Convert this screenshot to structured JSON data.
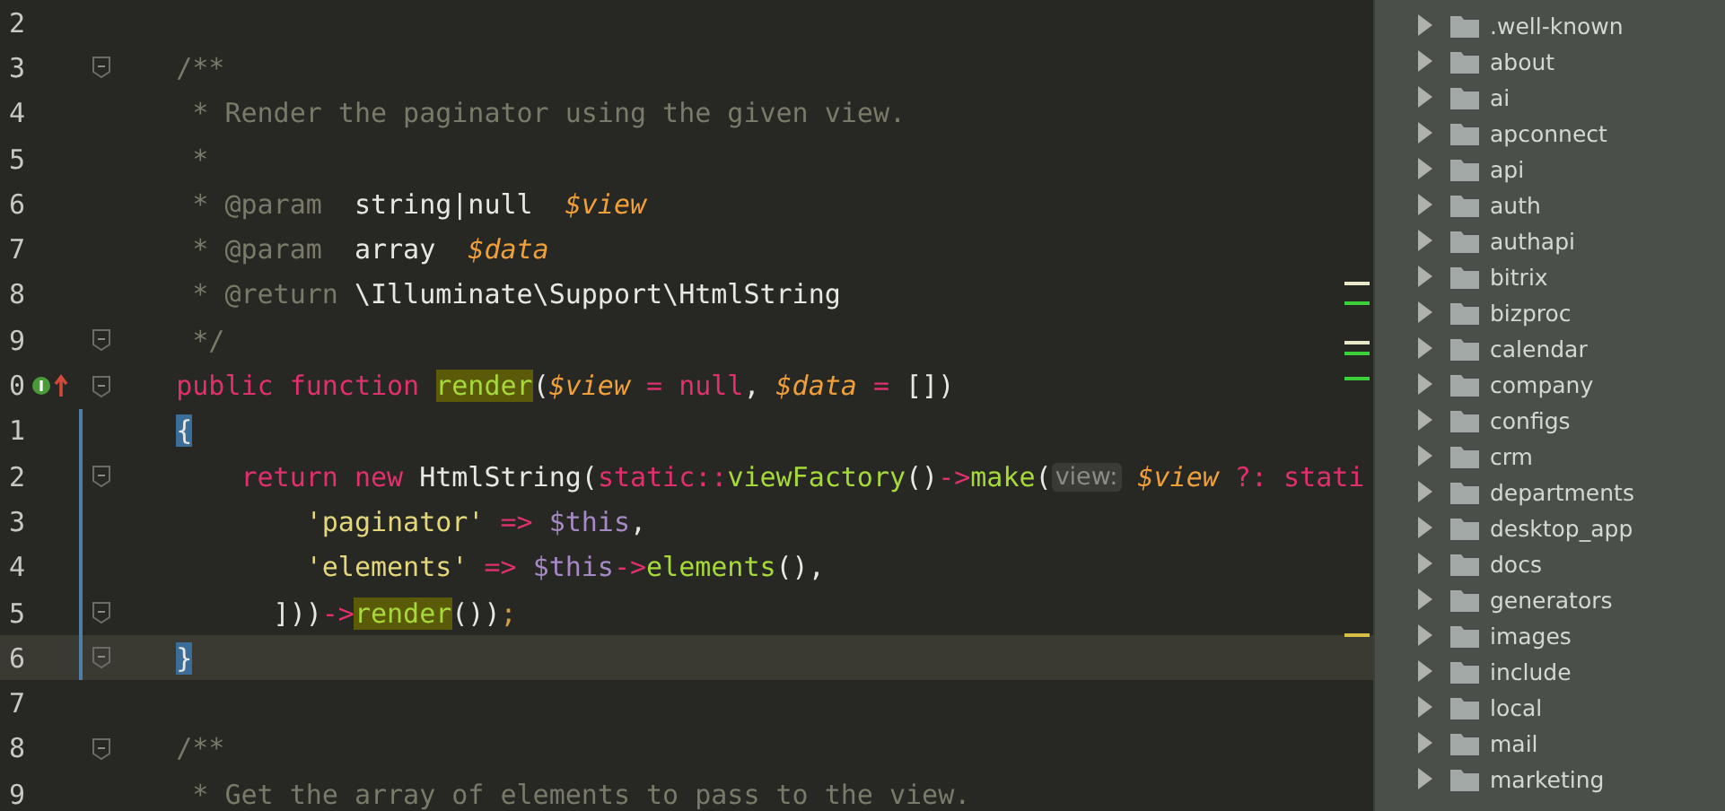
{
  "editor": {
    "lines": [
      {
        "number": "2",
        "fold": false,
        "current": false,
        "changed": false,
        "marker": false
      },
      {
        "number": "3",
        "fold": true,
        "current": false,
        "changed": false,
        "marker": false,
        "tokens": [
          {
            "t": "    /**",
            "kind": "comment"
          }
        ]
      },
      {
        "number": "4",
        "fold": false,
        "current": false,
        "changed": false,
        "marker": false,
        "tokens": [
          {
            "t": "     * Render the paginator using the given view.",
            "kind": "comment"
          }
        ]
      },
      {
        "number": "5",
        "fold": false,
        "current": false,
        "changed": false,
        "marker": false,
        "tokens": [
          {
            "t": "     *",
            "kind": "comment"
          }
        ]
      },
      {
        "number": "6",
        "fold": false,
        "current": false,
        "changed": false,
        "marker": false,
        "tokens": [
          {
            "t": "     * ",
            "kind": "comment"
          },
          {
            "t": "@param",
            "kind": "doctag"
          },
          {
            "t": "  string|null  ",
            "kind": "type"
          },
          {
            "t": "$view",
            "kind": "var"
          }
        ]
      },
      {
        "number": "7",
        "fold": false,
        "current": false,
        "changed": false,
        "marker": false,
        "tokens": [
          {
            "t": "     * ",
            "kind": "comment"
          },
          {
            "t": "@param",
            "kind": "doctag"
          },
          {
            "t": "  array  ",
            "kind": "type"
          },
          {
            "t": "$data",
            "kind": "var"
          }
        ]
      },
      {
        "number": "8",
        "fold": false,
        "current": false,
        "changed": false,
        "marker": false,
        "tokens": [
          {
            "t": "     * ",
            "kind": "comment"
          },
          {
            "t": "@return",
            "kind": "doctag"
          },
          {
            "t": " \\Illuminate\\Support\\HtmlString",
            "kind": "type"
          }
        ]
      },
      {
        "number": "9",
        "fold": true,
        "current": false,
        "changed": false,
        "marker": false,
        "tokens": [
          {
            "t": "     */",
            "kind": "comment"
          }
        ]
      },
      {
        "number": "0",
        "fold": true,
        "current": false,
        "changed": false,
        "marker": true,
        "tokens": [
          {
            "t": "    public function ",
            "kind": "keyword"
          },
          {
            "t": "render",
            "kind": "func",
            "highlighted": true
          },
          {
            "t": "(",
            "kind": "plain"
          },
          {
            "t": "$view",
            "kind": "var"
          },
          {
            "t": " = ",
            "kind": "op"
          },
          {
            "t": "null",
            "kind": "keyword"
          },
          {
            "t": ", ",
            "kind": "plain"
          },
          {
            "t": "$data",
            "kind": "var"
          },
          {
            "t": " = ",
            "kind": "op"
          },
          {
            "t": "[])",
            "kind": "plain"
          }
        ]
      },
      {
        "number": "1",
        "fold": false,
        "current": false,
        "changed": true,
        "marker": false,
        "tokens": [
          {
            "t": "    {",
            "kind": "brace"
          }
        ]
      },
      {
        "number": "2",
        "fold": true,
        "current": false,
        "changed": true,
        "marker": false,
        "tokens": [
          {
            "t": "        return new ",
            "kind": "keyword"
          },
          {
            "t": "HtmlString(",
            "kind": "plain"
          },
          {
            "t": "static",
            "kind": "keyword"
          },
          {
            "t": "::",
            "kind": "op"
          },
          {
            "t": "viewFactory",
            "kind": "func"
          },
          {
            "t": "()",
            "kind": "plain"
          },
          {
            "t": "->",
            "kind": "op"
          },
          {
            "t": "make",
            "kind": "func"
          },
          {
            "t": "(",
            "kind": "plain"
          },
          {
            "t": "view:",
            "kind": "hint"
          },
          {
            "t": " $view",
            "kind": "var"
          },
          {
            "t": " ?: ",
            "kind": "op"
          },
          {
            "t": "stati",
            "kind": "keyword"
          }
        ]
      },
      {
        "number": "3",
        "fold": false,
        "current": false,
        "changed": true,
        "marker": false,
        "tokens": [
          {
            "t": "            'paginator'",
            "kind": "string"
          },
          {
            "t": " => ",
            "kind": "op"
          },
          {
            "t": "$this",
            "kind": "this"
          },
          {
            "t": ",",
            "kind": "plain"
          }
        ]
      },
      {
        "number": "4",
        "fold": false,
        "current": false,
        "changed": true,
        "marker": false,
        "tokens": [
          {
            "t": "            'elements'",
            "kind": "string"
          },
          {
            "t": " => ",
            "kind": "op"
          },
          {
            "t": "$this",
            "kind": "this"
          },
          {
            "t": "->",
            "kind": "op"
          },
          {
            "t": "elements",
            "kind": "func"
          },
          {
            "t": "(),",
            "kind": "plain"
          }
        ]
      },
      {
        "number": "5",
        "fold": true,
        "current": false,
        "changed": true,
        "marker": false,
        "tokens": [
          {
            "t": "          ]))",
            "kind": "plain"
          },
          {
            "t": "->",
            "kind": "op"
          },
          {
            "t": "render",
            "kind": "func",
            "highlighted": true
          },
          {
            "t": "())",
            "kind": "plain"
          },
          {
            "t": ";",
            "kind": "semi"
          }
        ]
      },
      {
        "number": "6",
        "fold": true,
        "current": true,
        "changed": true,
        "marker": false,
        "tokens": [
          {
            "t": "    }",
            "kind": "brace"
          }
        ]
      },
      {
        "number": "7",
        "fold": false,
        "current": false,
        "changed": false,
        "marker": false
      },
      {
        "number": "8",
        "fold": true,
        "current": false,
        "changed": false,
        "marker": false,
        "tokens": [
          {
            "t": "    /**",
            "kind": "comment"
          }
        ]
      },
      {
        "number": "9",
        "fold": false,
        "current": false,
        "changed": false,
        "marker": false,
        "tokens": [
          {
            "t": "     * Get the array of elements to pass to the view.",
            "kind": "comment"
          }
        ]
      }
    ]
  },
  "project_tree": {
    "items": [
      {
        "name": ".well-known",
        "expanded": false
      },
      {
        "name": "about",
        "expanded": false
      },
      {
        "name": "ai",
        "expanded": false
      },
      {
        "name": "apconnect",
        "expanded": false
      },
      {
        "name": "api",
        "expanded": false
      },
      {
        "name": "auth",
        "expanded": false
      },
      {
        "name": "authapi",
        "expanded": false
      },
      {
        "name": "bitrix",
        "expanded": false
      },
      {
        "name": "bizproc",
        "expanded": false
      },
      {
        "name": "calendar",
        "expanded": false
      },
      {
        "name": "company",
        "expanded": false
      },
      {
        "name": "configs",
        "expanded": false
      },
      {
        "name": "crm",
        "expanded": false
      },
      {
        "name": "departments",
        "expanded": false
      },
      {
        "name": "desktop_app",
        "expanded": false
      },
      {
        "name": "docs",
        "expanded": false
      },
      {
        "name": "generators",
        "expanded": false
      },
      {
        "name": "images",
        "expanded": false
      },
      {
        "name": "include",
        "expanded": false
      },
      {
        "name": "local",
        "expanded": false
      },
      {
        "name": "mail",
        "expanded": false
      },
      {
        "name": "marketing",
        "expanded": false
      }
    ]
  }
}
